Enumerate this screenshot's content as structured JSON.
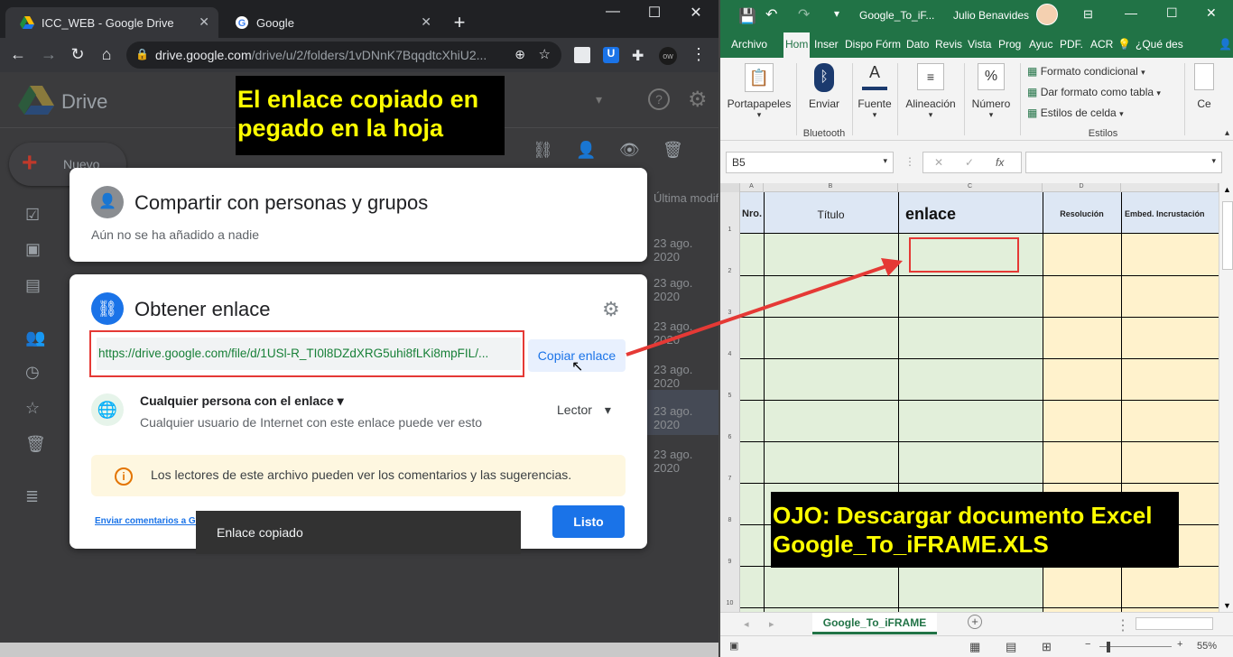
{
  "chrome": {
    "tabs": [
      {
        "title": "ICC_WEB - Google Drive",
        "active": true
      },
      {
        "title": "Google",
        "active": false
      }
    ],
    "new_tab": "+",
    "window": {
      "minimize": "—",
      "maximize": "☐",
      "close": "✕"
    },
    "url_host": "drive.google.com",
    "url_path": "/drive/u/2/folders/1vDNnK7BqqdtcXhiU2..."
  },
  "drive": {
    "title": "Drive",
    "new_button": "Nuevo",
    "column_header": "Última modifi",
    "dates": [
      "23 ago. 2020",
      "23 ago. 2020",
      "23 ago. 2020",
      "23 ago. 2020",
      "23 ago. 2020",
      "23 ago. 2020"
    ]
  },
  "dialog": {
    "share_title": "Compartir con personas y grupos",
    "share_subtitle": "Aún no se ha añadido a nadie",
    "link_title": "Obtener enlace",
    "link_url": "https://drive.google.com/file/d/1USl-R_TI0l8DZdXRG5uhi8fLKi8mpFIL/...",
    "copy_button": "Copiar enlace",
    "access_label": "Cualquier persona con el enlace",
    "access_desc": "Cualquier usuario de Internet con este enlace puede ver esto",
    "role": "Lector",
    "info_text": "Los lectores de este archivo pueden ver los comentarios y las sugerencias.",
    "feedback_link": "Enviar comentarios a Go",
    "done_button": "Listo",
    "toast": "Enlace copiado"
  },
  "callouts": {
    "left_line1": "El enlace copiado en",
    "left_line2": "pegado en la hoja",
    "right_line1": "OJO: Descargar documento Excel",
    "right_line2": "Google_To_iFRAME.XLS"
  },
  "excel": {
    "doc_title": "Google_To_iF...",
    "user": "Julio Benavides",
    "menu": [
      "Archivo",
      "Hom",
      "Inser",
      "Dispo",
      "Fórm",
      "Dato",
      "Revis",
      "Vista",
      "Prog",
      "Ayuc",
      "PDF.",
      "ACR",
      "¿Qué des"
    ],
    "active_menu": "Hom",
    "ribbon": {
      "portapapeles": "Portapapeles",
      "enviar": "Enviar",
      "bluetooth": "Bluetooth",
      "fuente": "Fuente",
      "alineacion": "Alineación",
      "numero": "Número",
      "formato_condicional": "Formato condicional",
      "dar_formato_tabla": "Dar formato como tabla",
      "estilos_celda": "Estilos de celda",
      "estilos": "Estilos",
      "ce": "Ce"
    },
    "name_box": "B5",
    "fx": "fx",
    "columns": [
      "A",
      "B",
      "C",
      "D"
    ],
    "headers": [
      "Nro.",
      "Título",
      "enlace",
      "Resolución",
      "Embed. Incrustación"
    ],
    "rows": [
      "1",
      "2",
      "3",
      "4",
      "5",
      "6",
      "7",
      "8",
      "9",
      "10"
    ],
    "sheet_tab": "Google_To_iFRAME",
    "zoom": "55%",
    "colors": {
      "green": "#217346",
      "cell_green": "#e2efda",
      "cell_yellow": "#fff2cc",
      "header_blue": "#dde7f4"
    }
  }
}
